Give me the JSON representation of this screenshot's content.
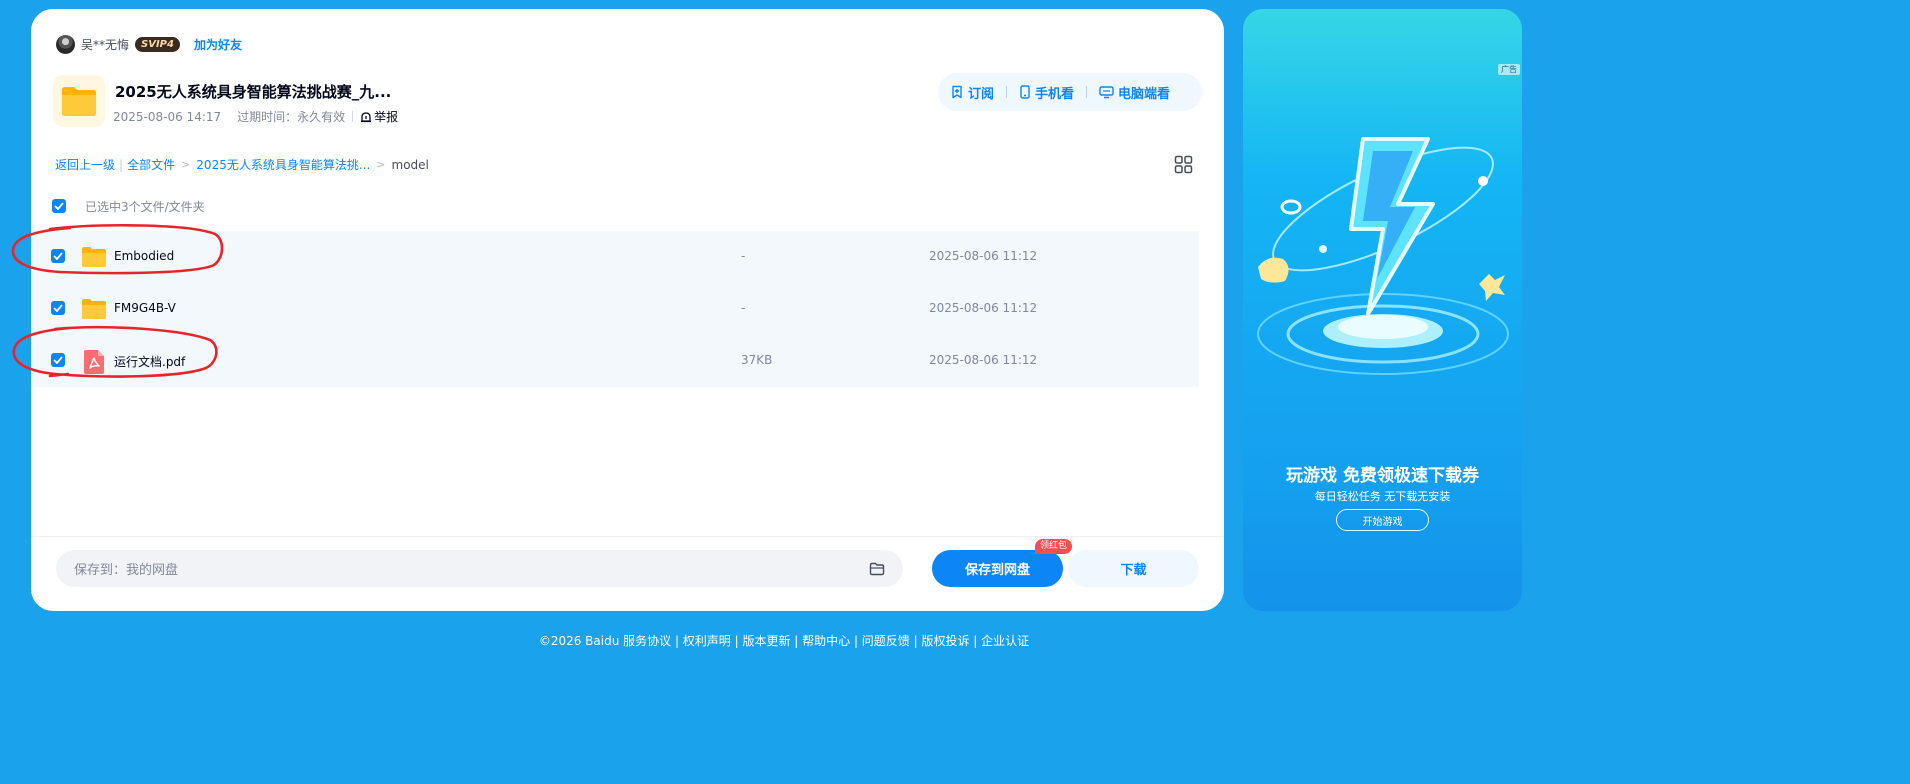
{
  "sharer": {
    "name": "吴**无悔",
    "badge": "SVIP4",
    "add_friend": "加为好友"
  },
  "share": {
    "title": "2025无人系统具身智能算法挑战赛_九...",
    "created": "2025-08-06 14:17",
    "expire": "过期时间：永久有效",
    "report": "举报"
  },
  "actions": {
    "subscribe": "订阅",
    "mobile": "手机看",
    "pc": "电脑端看"
  },
  "breadcrumb": {
    "back": "返回上一级",
    "all_files": "全部文件",
    "folder": "2025无人系统具身智能算法挑...",
    "current": "model"
  },
  "selection": {
    "summary": "已选中3个文件/文件夹"
  },
  "files": [
    {
      "name": "Embodied",
      "size": "-",
      "date": "2025-08-06 11:12",
      "type": "folder",
      "checked": true,
      "circled": true
    },
    {
      "name": "FM9G4B-V",
      "size": "-",
      "date": "2025-08-06 11:12",
      "type": "folder",
      "checked": true,
      "circled": false
    },
    {
      "name": "运行文档.pdf",
      "size": "37KB",
      "date": "2025-08-06 11:12",
      "type": "pdf",
      "checked": true,
      "circled": true
    }
  ],
  "bottom": {
    "save_path": "保存到：我的网盘",
    "save_button": "保存到网盘",
    "hongbao": "领红包",
    "download": "下载"
  },
  "ad": {
    "tag": "广告",
    "headline": "玩游戏 免费领极速下载券",
    "sub": "每日轻松任务 无下载无安装",
    "cta": "开始游戏"
  },
  "footer": {
    "text": "©2026 Baidu  服务协议 | 权利声明 | 版本更新 | 帮助中心 | 问题反馈 | 版权投诉 | 企业认证"
  },
  "colors": {
    "page_bg": "#1aa3ec",
    "accent": "#0d86f5",
    "row_bg": "#f3f8fd",
    "annotation": "#e8242b"
  }
}
